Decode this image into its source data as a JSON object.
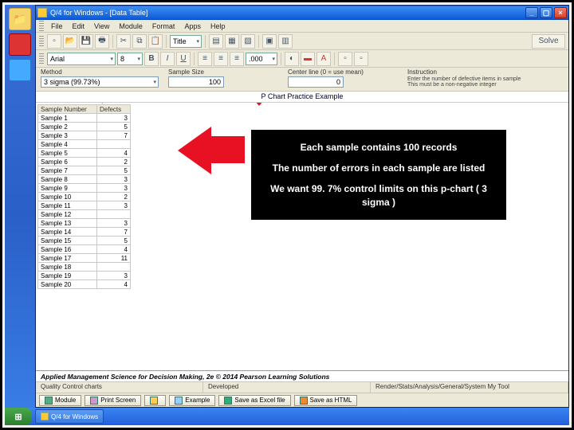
{
  "title": "Q/4 for Windows - [Data Table]",
  "menus": [
    "File",
    "Edit",
    "View",
    "Module",
    "Format",
    "Apps",
    "Help"
  ],
  "font": {
    "name": "Arial",
    "size": "8",
    "zoom": ".000"
  },
  "toolbar_labels": {
    "solve": "Solve"
  },
  "params": {
    "method_label": "Method",
    "method_value": "3 sigma (99.73%)",
    "sample_label": "Sample Size",
    "sample_value": "100",
    "center_label": "Center line (0 = use mean)",
    "center_value": "0",
    "instr_label": "Instruction",
    "instr_lines": [
      "Enter the number of defective items in sample",
      "This must be a non-negative integer"
    ]
  },
  "doc_title": "P Chart Practice Example",
  "columns": [
    "Sample Number",
    "Defects"
  ],
  "rows": [
    {
      "label": "Sample 1",
      "val": "3"
    },
    {
      "label": "Sample 2",
      "val": "5"
    },
    {
      "label": "Sample 3",
      "val": "7"
    },
    {
      "label": "Sample 4",
      "val": ""
    },
    {
      "label": "Sample 5",
      "val": "4"
    },
    {
      "label": "Sample 6",
      "val": "2"
    },
    {
      "label": "Sample 7",
      "val": "5"
    },
    {
      "label": "Sample 8",
      "val": "3"
    },
    {
      "label": "Sample 9",
      "val": "3"
    },
    {
      "label": "Sample 10",
      "val": "2"
    },
    {
      "label": "Sample 11",
      "val": "3"
    },
    {
      "label": "Sample 12",
      "val": ""
    },
    {
      "label": "Sample 13",
      "val": "3"
    },
    {
      "label": "Sample 14",
      "val": "7"
    },
    {
      "label": "Sample 15",
      "val": "5"
    },
    {
      "label": "Sample 16",
      "val": "4"
    },
    {
      "label": "Sample 17",
      "val": "11"
    },
    {
      "label": "Sample 18",
      "val": ""
    },
    {
      "label": "Sample 19",
      "val": "3"
    },
    {
      "label": "Sample 20",
      "val": "4"
    }
  ],
  "callout": {
    "l1": "Each sample contains 100 records",
    "l2": "The number of errors in each sample are listed",
    "l3": "We want 99. 7% control limits on this p-chart ( 3 sigma )"
  },
  "footer": "Applied Management Science for Decision Making, 2e © 2014 Pearson Learning Solutions",
  "status": {
    "left": "Quality Control charts",
    "mid": "Developed",
    "right": "Render/Stats/Analysis/General/System My Tool"
  },
  "bottom_buttons": [
    "Module",
    "Print Screen",
    "",
    "Example",
    "Save as Excel file",
    "Save as HTML"
  ],
  "taskbar_app": "Q/4 for Windows"
}
